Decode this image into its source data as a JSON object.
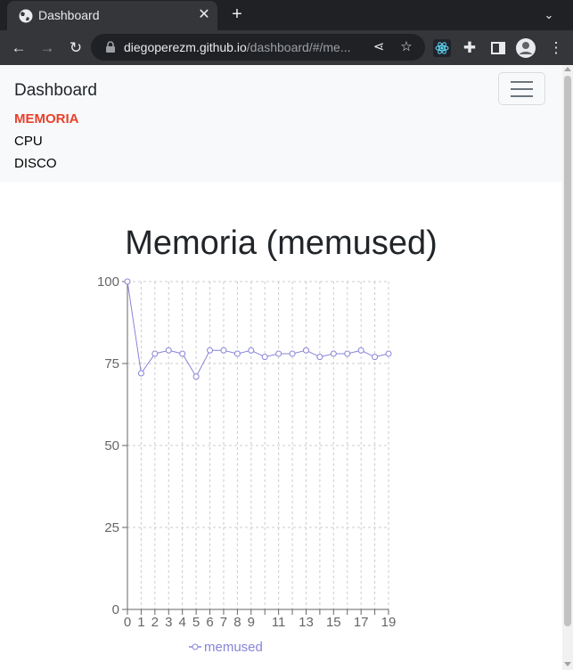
{
  "browser": {
    "tab_title": "Dashboard",
    "url_host": "diegoperezm.github.io",
    "url_path": "/dashboard/#/me..."
  },
  "navbar": {
    "brand": "Dashboard",
    "links": [
      "MEMORIA",
      "CPU",
      "DISCO"
    ],
    "active_link": "MEMORIA",
    "active_color": "#e8412c"
  },
  "chart_data": {
    "type": "line",
    "title": "Memoria (memused)",
    "x": [
      0,
      1,
      2,
      3,
      4,
      5,
      6,
      7,
      8,
      9,
      10,
      11,
      12,
      13,
      14,
      15,
      16,
      17,
      18,
      19
    ],
    "x_tick_labels": [
      "0",
      "1",
      "2",
      "3",
      "4",
      "5",
      "6",
      "7",
      "8",
      "9",
      "11",
      "13",
      "15",
      "17",
      "19"
    ],
    "series": [
      {
        "name": "memused",
        "color": "#8884d8",
        "values": [
          100,
          72,
          78,
          79,
          78,
          71,
          79,
          79,
          78,
          79,
          77,
          78,
          78,
          79,
          77,
          78,
          78,
          79,
          77,
          78
        ]
      }
    ],
    "ylim": [
      0,
      100
    ],
    "y_ticks": [
      0,
      25,
      50,
      75,
      100
    ],
    "grid": true,
    "legend": "bottom-center"
  }
}
